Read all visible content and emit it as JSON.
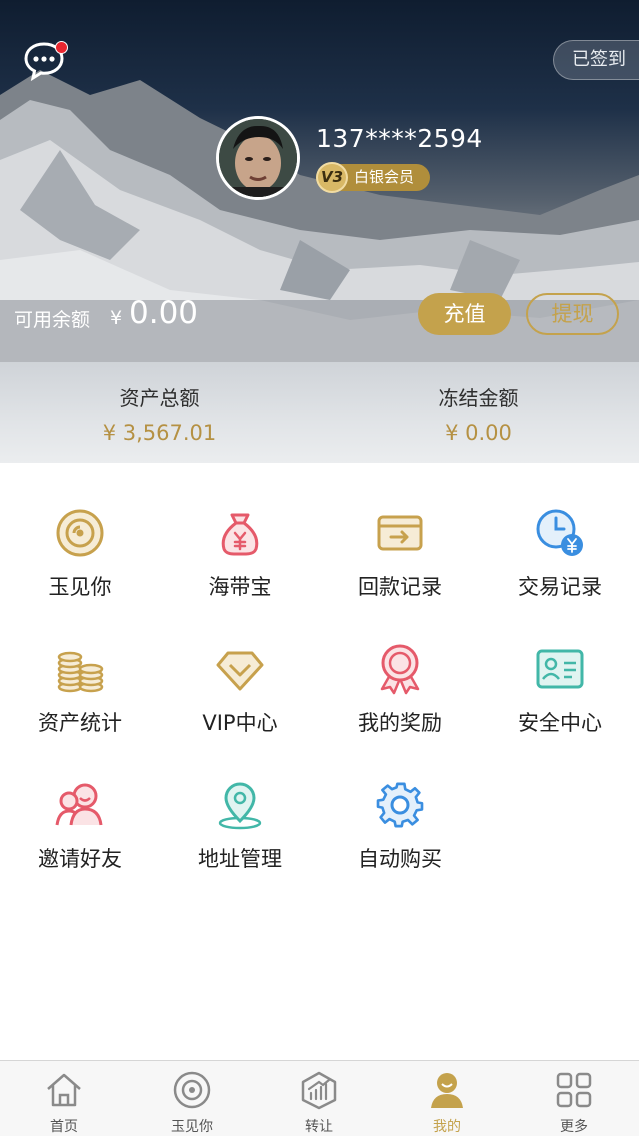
{
  "header": {
    "signin_label": "已签到",
    "phone": "137****2594",
    "vip_level": "V3",
    "member_level": "白银会员"
  },
  "balance": {
    "label": "可用余额",
    "currency": "¥",
    "value": "0.00",
    "recharge_label": "充值",
    "withdraw_label": "提现"
  },
  "assets": {
    "total_label": "资产总额",
    "total_value": "¥ 3,567.01",
    "frozen_label": "冻结金额",
    "frozen_value": "¥ 0.00"
  },
  "menu": [
    {
      "label": "玉见你",
      "icon": "jade-disc-icon",
      "color": "#c7a14d"
    },
    {
      "label": "海带宝",
      "icon": "money-bag-icon",
      "color": "#e55a6a"
    },
    {
      "label": "回款记录",
      "icon": "card-return-icon",
      "color": "#c7a14d"
    },
    {
      "label": "交易记录",
      "icon": "clock-yen-icon",
      "color": "#3a8ee0"
    },
    {
      "label": "资产统计",
      "icon": "coin-stacks-icon",
      "color": "#c7a14d"
    },
    {
      "label": "VIP中心",
      "icon": "diamond-icon",
      "color": "#c7a14d"
    },
    {
      "label": "我的奖励",
      "icon": "medal-icon",
      "color": "#e55a6a"
    },
    {
      "label": "安全中心",
      "icon": "id-card-icon",
      "color": "#42b7a8"
    },
    {
      "label": "邀请好友",
      "icon": "friends-icon",
      "color": "#e55a6a"
    },
    {
      "label": "地址管理",
      "icon": "location-pin-icon",
      "color": "#42b7a8"
    },
    {
      "label": "自动购买",
      "icon": "gear-icon",
      "color": "#3a8ee0"
    }
  ],
  "tabs": [
    {
      "label": "首页",
      "icon": "home-icon"
    },
    {
      "label": "玉见你",
      "icon": "jade-disc-icon"
    },
    {
      "label": "转让",
      "icon": "transfer-chart-icon"
    },
    {
      "label": "我的",
      "icon": "profile-icon",
      "active": true
    },
    {
      "label": "更多",
      "icon": "grid-icon"
    }
  ],
  "colors": {
    "gold": "#c4a24c",
    "red_dot": "#e8262f",
    "text": "#222222"
  }
}
